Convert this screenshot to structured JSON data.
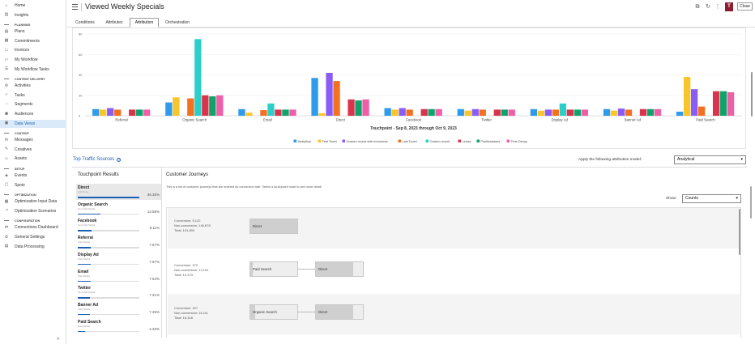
{
  "sidebar": {
    "items": [
      {
        "type": "item",
        "label": "Home",
        "icon": "home-icon",
        "glyph": "⌂"
      },
      {
        "type": "item",
        "label": "Insights",
        "icon": "insights-icon",
        "glyph": "▥"
      },
      {
        "type": "section",
        "label": "PLANNING"
      },
      {
        "type": "item",
        "label": "Plans",
        "icon": "plans-icon",
        "glyph": "▤"
      },
      {
        "type": "item",
        "label": "Commitments",
        "icon": "commitments-icon",
        "glyph": "▦"
      },
      {
        "type": "item",
        "label": "Invoices",
        "icon": "invoices-icon",
        "glyph": "▭"
      },
      {
        "type": "item",
        "label": "My Workflow",
        "icon": "workflow-icon",
        "glyph": "⚇"
      },
      {
        "type": "item",
        "label": "My Workflow Tasks",
        "icon": "workflow-tasks-icon",
        "glyph": "☰"
      },
      {
        "type": "section",
        "label": "CONTENT DELIVERY"
      },
      {
        "type": "item",
        "label": "Activities",
        "icon": "activities-icon",
        "glyph": "⚙"
      },
      {
        "type": "item",
        "label": "Tasks",
        "icon": "tasks-icon",
        "glyph": "✓"
      },
      {
        "type": "item",
        "label": "Segments",
        "icon": "segments-icon",
        "glyph": "◔"
      },
      {
        "type": "item",
        "label": "Audiences",
        "icon": "audiences-icon",
        "glyph": "⚉"
      },
      {
        "type": "item",
        "label": "Data Views",
        "icon": "data-views-icon",
        "glyph": "▣",
        "active": true
      },
      {
        "type": "section",
        "label": "CONTENT"
      },
      {
        "type": "item",
        "label": "Messages",
        "icon": "messages-icon",
        "glyph": "✉"
      },
      {
        "type": "item",
        "label": "Creatives",
        "icon": "creatives-icon",
        "glyph": "✎"
      },
      {
        "type": "item",
        "label": "Assets",
        "icon": "assets-icon",
        "glyph": "◇"
      },
      {
        "type": "section",
        "label": "SETUP"
      },
      {
        "type": "item",
        "label": "Events",
        "icon": "events-icon",
        "glyph": "◈"
      },
      {
        "type": "item",
        "label": "Spots",
        "icon": "spots-icon",
        "glyph": "▢"
      },
      {
        "type": "section",
        "label": "OPTIMIZATION"
      },
      {
        "type": "item",
        "label": "Optimization Input Data",
        "icon": "optimization-input-icon",
        "glyph": "▦"
      },
      {
        "type": "item",
        "label": "Optimization Scenarios",
        "icon": "optimization-scenarios-icon",
        "glyph": "↗"
      },
      {
        "type": "section",
        "label": "CONFIGURATION"
      },
      {
        "type": "item",
        "label": "Connections Dashboard",
        "icon": "connections-icon",
        "glyph": "⇄"
      },
      {
        "type": "item",
        "label": "General Settings",
        "icon": "settings-icon",
        "glyph": "⚙"
      },
      {
        "type": "item",
        "label": "Data Processing",
        "icon": "data-processing-icon",
        "glyph": "▤"
      }
    ],
    "collapse_glyph": "«"
  },
  "header": {
    "title": "Viewed Weekly Specials",
    "icons": [
      "copy-icon",
      "refresh-icon",
      "more-icon"
    ],
    "badge": "T",
    "close_label": "Close"
  },
  "tabs": [
    {
      "label": "Conditions"
    },
    {
      "label": "Attributes"
    },
    {
      "label": "Attribution",
      "active": true
    },
    {
      "label": "Orchestration"
    }
  ],
  "chart_data": {
    "type": "bar",
    "xlabel": "Touchpoint - Sep 8, 2023 through Oct 9, 2023",
    "ylabel": "",
    "yticks": [
      0,
      20,
      40,
      60,
      80
    ],
    "ylim": [
      0,
      80
    ],
    "grid": true,
    "legend_position": "bottom",
    "categories": [
      "Referral",
      "Organic Search",
      "Email",
      "Direct",
      "Facebook",
      "Twitter",
      "Display Ad",
      "Banner Ad",
      "Paid Search"
    ],
    "series": [
      {
        "name": "Analytical",
        "color": "#2f9bea",
        "values": [
          6.5,
          13,
          6.5,
          37,
          7.5,
          6.5,
          6.5,
          6.5,
          4
        ]
      },
      {
        "name": "First Touch",
        "color": "#f8c62b",
        "values": [
          6,
          18,
          3,
          2.5,
          6,
          5,
          5,
          5,
          38
        ]
      },
      {
        "name": "Custom recent with exclusions",
        "color": "#8a5cf6",
        "values": [
          7.5,
          0,
          0,
          42,
          7.5,
          6.5,
          6,
          7,
          26
        ]
      },
      {
        "name": "Last Touch",
        "color": "#f37021",
        "values": [
          6,
          17,
          5.5,
          34,
          6,
          6,
          6,
          6,
          9
        ]
      },
      {
        "name": "Custom recent",
        "color": "#2ccfc7",
        "values": [
          0,
          75,
          12,
          0,
          0,
          0,
          12,
          0,
          0
        ]
      },
      {
        "name": "Linear",
        "color": "#d8344d",
        "values": [
          6,
          20,
          6,
          16,
          6.5,
          6,
          6,
          6.5,
          24
        ]
      },
      {
        "name": "Positionbased",
        "color": "#0fa36b",
        "values": [
          6,
          19,
          6,
          15,
          6.5,
          6,
          6,
          6.5,
          24
        ]
      },
      {
        "name": "Time Decay",
        "color": "#ef5fa8",
        "values": [
          6,
          20,
          6,
          16,
          6.5,
          6,
          6,
          6.5,
          23
        ]
      }
    ]
  },
  "traffic": {
    "title": "Top Traffic Sources",
    "info_glyph": "?",
    "model_label": "Apply the following attribution model:",
    "model_value": "Analytical"
  },
  "touchpoints": {
    "title": "Touchpoint Results",
    "rows": [
      {
        "name": "Direct",
        "sub": "(nd) None",
        "pct_label": "36.35%",
        "pct": 36.35,
        "active": true
      },
      {
        "name": "Organic Search",
        "sub": "Non Paid Media",
        "pct_label": "13.58%",
        "pct": 13.58
      },
      {
        "name": "Facebook",
        "sub": "Non Paid Media",
        "pct_label": "8.11%",
        "pct": 8.11
      },
      {
        "name": "Referral",
        "sub": "Paid Media",
        "pct_label": "7.67%",
        "pct": 7.67
      },
      {
        "name": "Display Ad",
        "sub": "Paid Media",
        "pct_label": "7.67%",
        "pct": 7.67
      },
      {
        "name": "Email",
        "sub": "Paid Media",
        "pct_label": "7.64%",
        "pct": 7.64
      },
      {
        "name": "Twitter",
        "sub": "Non Paid Media",
        "pct_label": "7.41%",
        "pct": 7.41
      },
      {
        "name": "Banner Ad",
        "sub": "Paid Media",
        "pct_label": "7.25%",
        "pct": 7.25
      },
      {
        "name": "Paid Search",
        "sub": "Paid Media",
        "pct_label": "4.33%",
        "pct": 4.33
      }
    ]
  },
  "journeys": {
    "title": "Customer Journeys",
    "description": "This is a list of customer journeys that are ordered by conversion rate. Select a touchpoint node to see more detail.",
    "show_label": "Show:",
    "show_value": "Counts",
    "rows": [
      {
        "conversion": "Conversion: 5,122",
        "nonconversion": "Non-conversion: 146,678",
        "total": "Total: 141,800",
        "nodes": [
          {
            "label": "Direct",
            "fill": 1.0
          }
        ]
      },
      {
        "conversion": "Conversion: 272",
        "nonconversion": "Non-conversion: 12,101",
        "total": "Total: 12,373",
        "nodes": [
          {
            "label": "Paid Search",
            "fill": 0.05
          },
          {
            "label": "Direct",
            "fill": 0.8
          }
        ]
      },
      {
        "conversion": "Conversion: 207",
        "nonconversion": "Non-conversion: 16,111",
        "total": "Total: 16,318",
        "nodes": [
          {
            "label": "Organic Search",
            "fill": 0.1
          },
          {
            "label": "Direct",
            "fill": 0.8
          }
        ]
      }
    ]
  }
}
